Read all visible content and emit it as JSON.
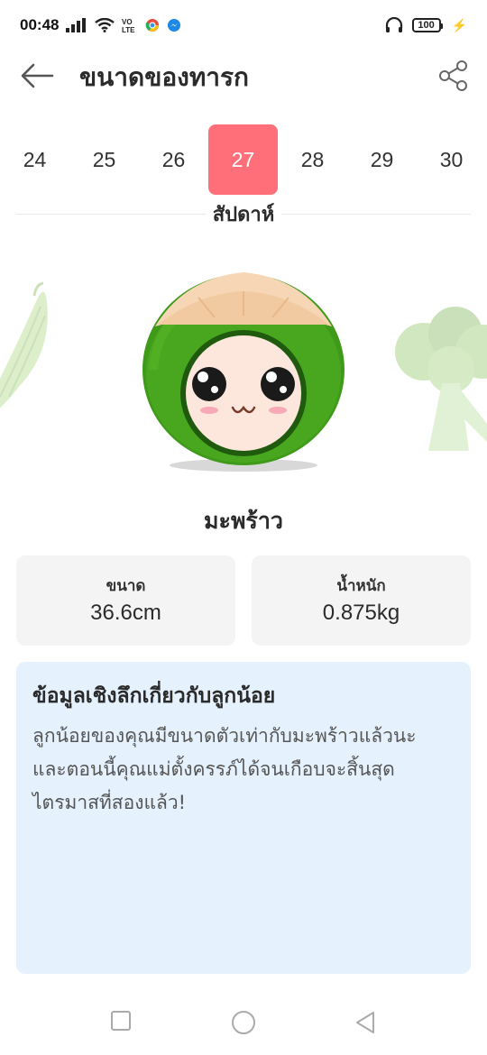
{
  "status": {
    "time": "00:48",
    "battery": "100",
    "icons": [
      "signal-icon",
      "wifi-icon",
      "volte-icon",
      "chrome-icon",
      "messenger-icon",
      "headphones-icon",
      "battery-icon",
      "charging-icon"
    ]
  },
  "header": {
    "title": "ขนาดของทารก"
  },
  "weeks": {
    "items": [
      "24",
      "25",
      "26",
      "27",
      "28",
      "29",
      "30"
    ],
    "selected": "27",
    "unit": "สัปดาห์"
  },
  "fruit": {
    "name": "มะพร้าว"
  },
  "stats": {
    "size_label": "ขนาด",
    "size_value": "36.6cm",
    "weight_label": "น้ำหนัก",
    "weight_value": "0.875kg"
  },
  "insight": {
    "title": "ข้อมูลเชิงลึกเกี่ยวกับลูกน้อย",
    "body": "ลูกน้อยของคุณมีขนาดตัวเท่ากับมะพร้าวแล้วนะ และตอนนี้คุณแม่ตั้งครรภ์ได้จนเกือบจะสิ้นสุดไตรมาสที่สองแล้ว!"
  },
  "colors": {
    "accent": "#ff6f7a",
    "card_bg": "#f4f4f5",
    "insight_bg": "#e5f1fc",
    "coconut_green": "#3f9a1a"
  }
}
